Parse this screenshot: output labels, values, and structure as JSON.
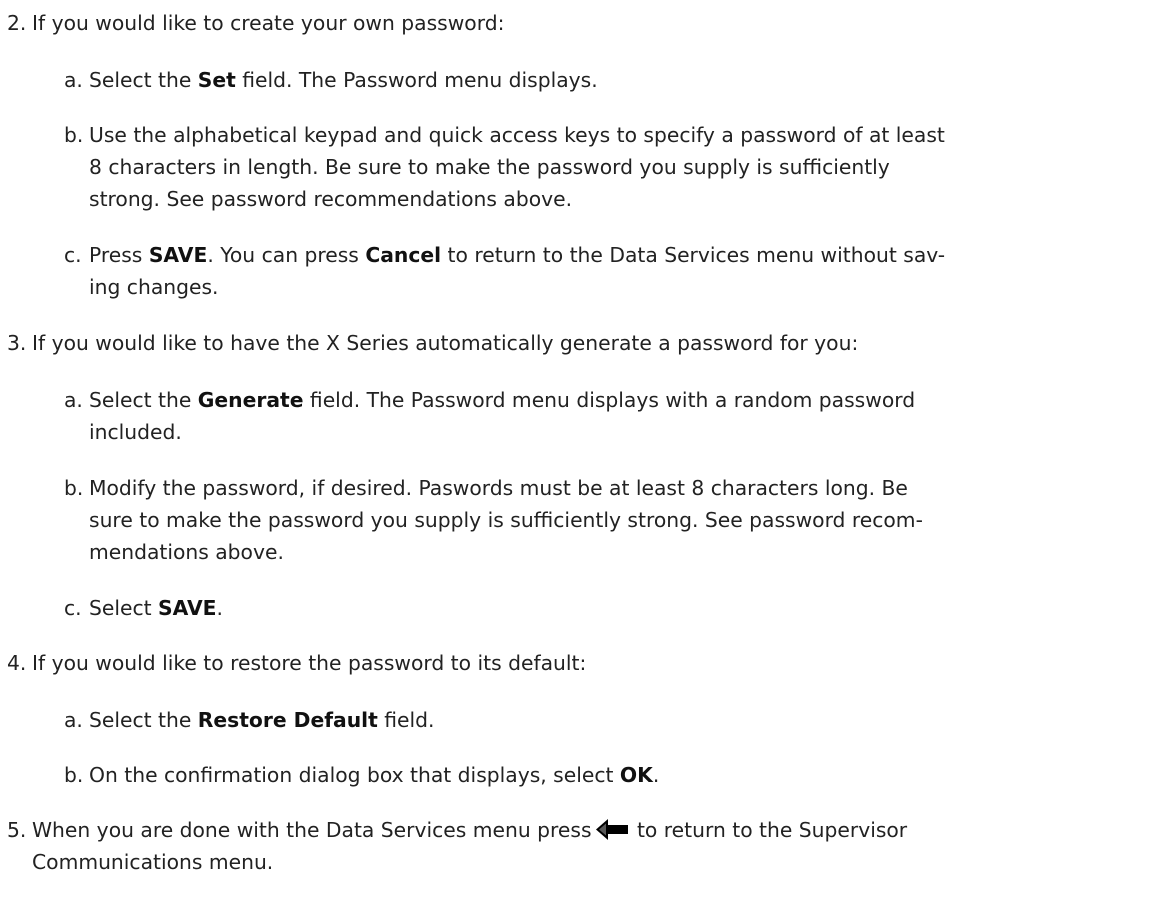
{
  "steps": [
    {
      "num": "2.",
      "text": "If you would like to create your own password:",
      "subs": [
        {
          "letter": "a.",
          "lines": [
            [
              "Select the ",
              {
                "b": "Set"
              },
              " field. The Password menu displays."
            ]
          ]
        },
        {
          "letter": "b.",
          "lines": [
            [
              "Use the alphabetical keypad and quick access keys to specify a password of at least"
            ],
            [
              "8 characters in length. Be sure to make the password you supply is sufficiently"
            ],
            [
              "strong. See password recommendations above."
            ]
          ]
        },
        {
          "letter": "c.",
          "lines": [
            [
              "Press ",
              {
                "b": "SAVE"
              },
              ". You can press ",
              {
                "b": "Cancel"
              },
              " to return to the Data Services menu without sav-"
            ],
            [
              "ing changes."
            ]
          ]
        }
      ]
    },
    {
      "num": "3.",
      "text": "If you would like to have the X Series automatically generate a password for you:",
      "subs": [
        {
          "letter": "a.",
          "lines": [
            [
              "Select the ",
              {
                "b": "Generate"
              },
              " field. The Password menu displays with a random password"
            ],
            [
              "included."
            ]
          ]
        },
        {
          "letter": "b.",
          "lines": [
            [
              "Modify the password, if desired. Paswords must be at least 8 characters long. Be"
            ],
            [
              "sure to make the password you supply is sufficiently strong. See password recom-"
            ],
            [
              "mendations above."
            ]
          ]
        },
        {
          "letter": "c.",
          "lines": [
            [
              "Select ",
              {
                "b": "SAVE"
              },
              "."
            ]
          ]
        }
      ]
    },
    {
      "num": "4.",
      "text": "If you would like to restore the password to its default:",
      "subs": [
        {
          "letter": "a.",
          "lines": [
            [
              "Select the ",
              {
                "b": "Restore Default"
              },
              " field."
            ]
          ]
        },
        {
          "letter": "b.",
          "lines": [
            [
              "On the confirmation dialog box that displays, select ",
              {
                "b": "OK"
              },
              "."
            ]
          ]
        }
      ]
    }
  ],
  "final_step": {
    "num": "5.",
    "text_before_icon": "When you are done with the Data Services menu press",
    "icon": "back-arrow-icon",
    "text_after_icon": " to return to the Supervisor",
    "text_line2": "Communications menu."
  },
  "colors": {
    "text": "#222222",
    "icon": "#000000"
  }
}
